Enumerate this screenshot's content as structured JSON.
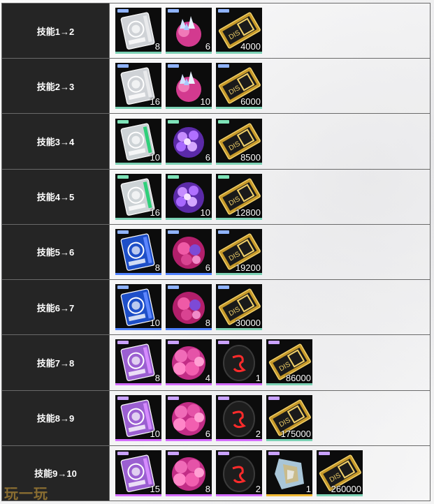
{
  "rows": [
    {
      "level": "技能1→2",
      "items": [
        {
          "icon": "chip-icon",
          "q": "8"
        },
        {
          "icon": "crystal-cluster-icon",
          "q": "6"
        },
        {
          "icon": "dis-ticket-icon",
          "q": "4000"
        }
      ]
    },
    {
      "level": "技能2→3",
      "items": [
        {
          "icon": "chip-icon",
          "q": "16"
        },
        {
          "icon": "crystal-cluster-icon",
          "q": "10"
        },
        {
          "icon": "dis-ticket-icon",
          "q": "6000"
        }
      ]
    },
    {
      "level": "技能3→4",
      "items": [
        {
          "icon": "chip-icon",
          "q": "10"
        },
        {
          "icon": "orb-cluster-icon",
          "q": "6"
        },
        {
          "icon": "dis-ticket-icon",
          "q": "8500"
        }
      ]
    },
    {
      "level": "技能4→5",
      "items": [
        {
          "icon": "chip-icon",
          "q": "16"
        },
        {
          "icon": "orb-cluster-icon",
          "q": "10"
        },
        {
          "icon": "dis-ticket-icon",
          "q": "12800"
        }
      ]
    },
    {
      "level": "技能5→6",
      "items": [
        {
          "icon": "chip-icon",
          "q": "8"
        },
        {
          "icon": "berry-orb-icon",
          "q": "6"
        },
        {
          "icon": "dis-ticket-icon",
          "q": "19200"
        }
      ]
    },
    {
      "level": "技能6→7",
      "items": [
        {
          "icon": "chip-icon",
          "q": "10"
        },
        {
          "icon": "berry-orb-icon",
          "q": "8"
        },
        {
          "icon": "dis-ticket-icon",
          "q": "30000"
        }
      ]
    },
    {
      "level": "技能7→8",
      "items": [
        {
          "icon": "chip-icon",
          "q": "8"
        },
        {
          "icon": "bubble-cluster-icon",
          "q": "4"
        },
        {
          "icon": "dark-stone-icon",
          "q": "1"
        },
        {
          "icon": "dis-ticket-icon",
          "q": "86000"
        }
      ]
    },
    {
      "level": "技能8→9",
      "items": [
        {
          "icon": "chip-icon",
          "q": "10"
        },
        {
          "icon": "bubble-cluster-icon",
          "q": "6"
        },
        {
          "icon": "dark-stone-icon",
          "q": "2"
        },
        {
          "icon": "dis-ticket-icon",
          "q": "175000"
        }
      ]
    },
    {
      "level": "技能9→10",
      "items": [
        {
          "icon": "chip-icon",
          "q": "15"
        },
        {
          "icon": "bubble-cluster-icon",
          "q": "8"
        },
        {
          "icon": "dark-stone-icon",
          "q": "2"
        },
        {
          "icon": "crystal-gem-icon",
          "q": "1"
        },
        {
          "icon": "dis-ticket-icon",
          "q": "260000"
        }
      ]
    }
  ],
  "watermark": "玩一玩"
}
